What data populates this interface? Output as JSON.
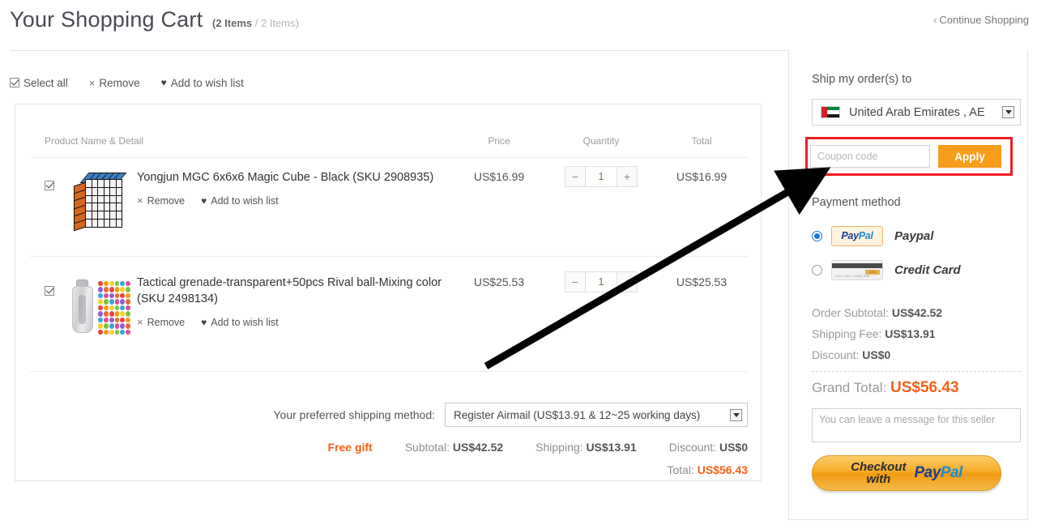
{
  "header": {
    "title": "Your Shopping Cart",
    "items_selected": "(2 Items",
    "items_separator": " / ",
    "items_total": "2 Items)",
    "continue_shopping": "Continue Shopping",
    "chevron": "‹"
  },
  "toolbar": {
    "select_all": "Select all",
    "remove": "Remove",
    "add_to_wish_list": "Add to wish list",
    "x_glyph": "×",
    "heart_glyph": "♥"
  },
  "table": {
    "columns": {
      "product": "Product Name & Detail",
      "price": "Price",
      "quantity": "Quantity",
      "total": "Total"
    },
    "rows": [
      {
        "name": "Yongjun MGC 6x6x6 Magic Cube - Black (SKU 2908935)",
        "price": "US$16.99",
        "quantity": "1",
        "total": "US$16.99",
        "remove": "Remove",
        "wish": "Add to wish list",
        "minus": "−",
        "plus": "+"
      },
      {
        "name": "Tactical grenade-transparent+50pcs Rival ball-Mixing color (SKU 2498134)",
        "price": "US$25.53",
        "quantity": "1",
        "total": "US$25.53",
        "remove": "Remove",
        "wish": "Add to wish list",
        "minus": "−",
        "plus": "+"
      }
    ]
  },
  "shipping_method": {
    "label": "Your preferred shipping method:",
    "selected": "Register Airmail (US$13.91 & 12~25 working days)"
  },
  "cart_totals": {
    "free_gift": "Free gift",
    "subtotal_label": "Subtotal:",
    "subtotal_value": "US$42.52",
    "shipping_label": "Shipping:",
    "shipping_value": "US$13.91",
    "discount_label": "Discount:",
    "discount_value": "US$0",
    "total_label": "Total:",
    "total_value": "US$56.43"
  },
  "sidebar": {
    "ship_to_label": "Ship my order(s) to",
    "country": "United Arab Emirates , AE",
    "coupon_placeholder": "Coupon code",
    "coupon_value": "",
    "apply_label": "Apply",
    "payment_label": "Payment method",
    "payment_options": [
      {
        "name": "Paypal",
        "selected": true
      },
      {
        "name": "Credit Card",
        "selected": false
      }
    ],
    "paypal_mark_1": "Pay",
    "paypal_mark_2": "Pal",
    "card_digits": "1234",
    "card_micro": "1234 4567 8888 888",
    "summary": {
      "subtotal_label": "Order Subtotal:",
      "subtotal_value": "US$42.52",
      "shipping_label": "Shipping Fee:",
      "shipping_value": "US$13.91",
      "discount_label": "Discount:",
      "discount_value": "US$0",
      "grand_total_label": "Grand Total:",
      "grand_total_value": "US$56.43"
    },
    "message_placeholder": "You can leave a message for this seller",
    "message_value": "",
    "checkout_line1": "Checkout",
    "checkout_line2": "with",
    "checkout_pp_1": "Pay",
    "checkout_pp_2": "Pal"
  },
  "colors": {
    "accent_orange": "#f4601a",
    "apply_orange": "#f99d1c",
    "highlight_red": "#ee1c24",
    "paypal_blue": "#1b3d8f",
    "radio_blue": "#1c78d4"
  }
}
